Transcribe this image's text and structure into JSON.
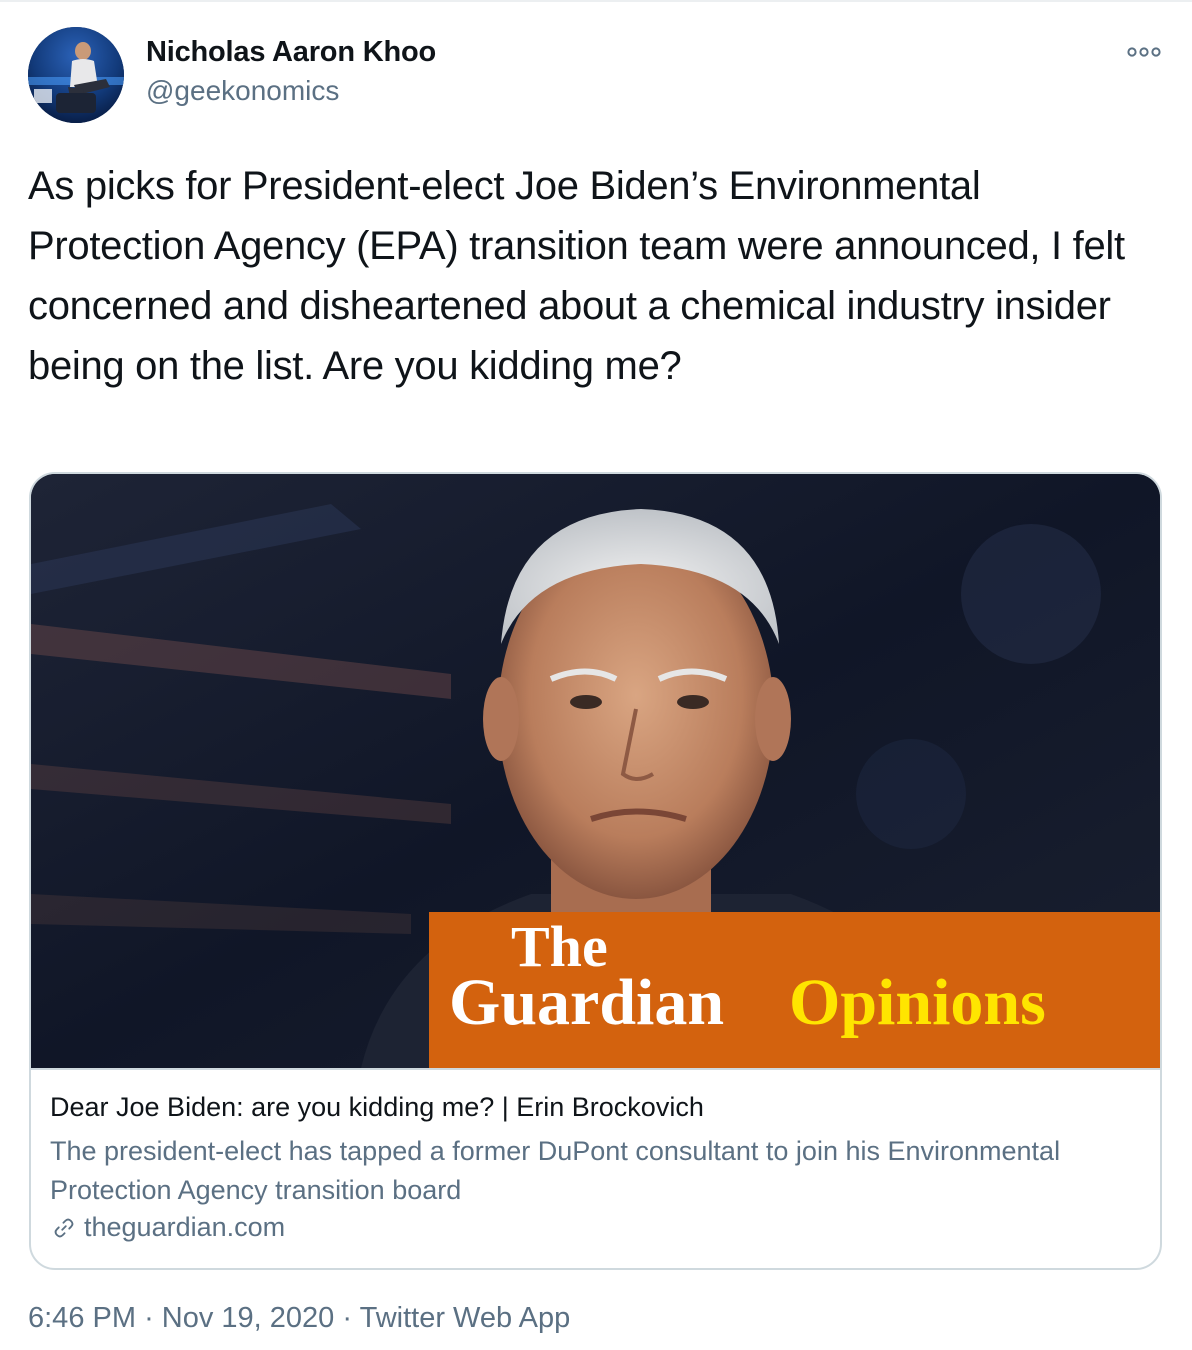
{
  "author": {
    "name": "Nicholas Aaron Khoo",
    "handle": "@geekonomics"
  },
  "tweet": {
    "text": "As picks for President-elect Joe Biden’s Environmental Protection Agency (EPA) transition team were announced, I felt concerned and disheartened about a chemical industry insider being on the list. Are you kidding me?"
  },
  "card": {
    "brand": {
      "line1": "The",
      "line2": "Guardian",
      "section": "Opinions",
      "box_color": "#d3620e",
      "section_color": "#ffe500"
    },
    "title": "Dear Joe Biden: are you kidding me? | Erin Brockovich",
    "description": "The president-elect has tapped a former DuPont consultant to join his Environmental Protection Agency transition board",
    "domain": "theguardian.com",
    "domain_icon": "link-icon"
  },
  "meta": {
    "time": "6:46 PM",
    "separator": "·",
    "date": "Nov 19, 2020",
    "source": "Twitter Web App"
  },
  "icons": {
    "more": "more-options-icon"
  },
  "colors": {
    "text_primary": "#0f1419",
    "text_secondary": "#5b7083",
    "border": "#cfd9de"
  }
}
